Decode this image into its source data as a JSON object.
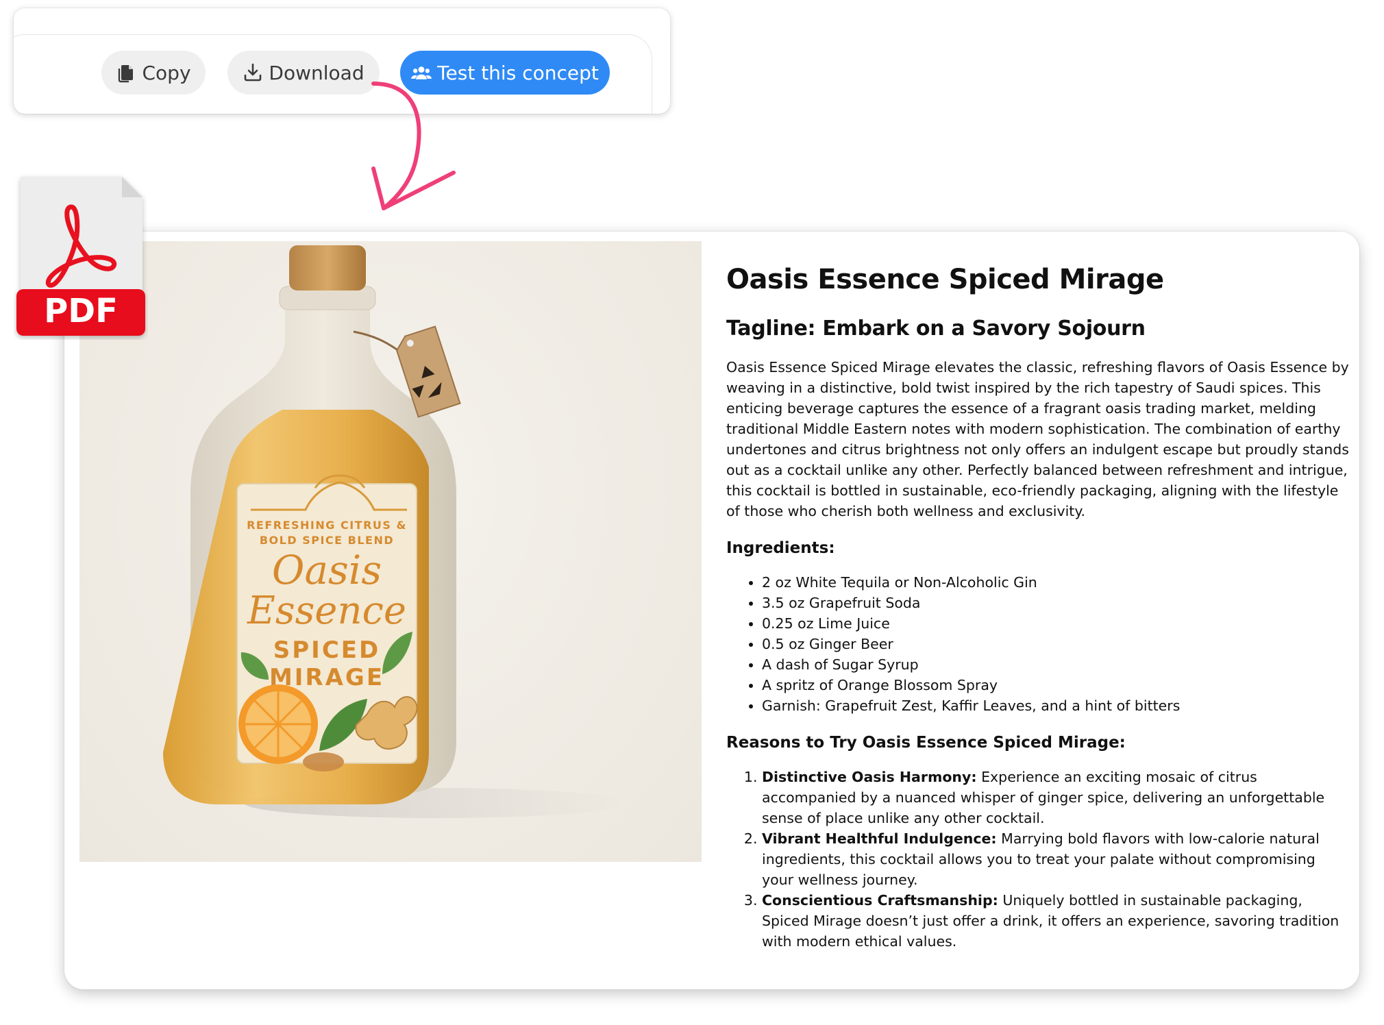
{
  "toolbar": {
    "copy_label": "Copy",
    "download_label": "Download",
    "test_label": "Test this concept",
    "accent_color": "#2f8af5"
  },
  "pdf_badge": {
    "label": "PDF",
    "color": "#e8111f"
  },
  "product_label": {
    "line1": "REFRESHING CITRUS &",
    "line2": "BOLD SPICE BLEND",
    "brand_1": "Oasis",
    "brand_2": "Essence",
    "name_1": "SPICED",
    "name_2": "MIRAGE"
  },
  "document": {
    "title": "Oasis Essence Spiced Mirage",
    "tagline": "Tagline: Embark on a Savory Sojourn",
    "description": "Oasis Essence Spiced Mirage elevates the classic, refreshing flavors of Oasis Essence by weaving in a distinctive, bold twist inspired by the rich tapestry of Saudi spices. This enticing beverage captures the essence of a fragrant oasis trading market, melding traditional Middle Eastern notes with modern sophistication. The combination of earthy undertones and citrus brightness not only offers an indulgent escape but proudly stands out as a cocktail unlike any other. Perfectly balanced between refreshment and intrigue, this cocktail is bottled in sustainable, eco-friendly packaging, aligning with the lifestyle of those who cherish both wellness and exclusivity.",
    "ingredients_heading": "Ingredients:",
    "ingredients": [
      "2 oz White Tequila or Non-Alcoholic Gin",
      "3.5 oz Grapefruit Soda",
      "0.25 oz Lime Juice",
      "0.5 oz Ginger Beer",
      "A dash of Sugar Syrup",
      "A spritz of Orange Blossom Spray",
      "Garnish: Grapefruit Zest, Kaffir Leaves, and a hint of bitters"
    ],
    "reasons_heading": "Reasons to Try Oasis Essence Spiced Mirage:",
    "reasons": [
      {
        "title": "Distinctive Oasis Harmony:",
        "text": " Experience an exciting mosaic of citrus accompanied by a nuanced whisper of ginger spice, delivering an unforgettable sense of place unlike any other cocktail."
      },
      {
        "title": "Vibrant Healthful Indulgence:",
        "text": " Marrying bold flavors with low-calorie natural ingredients, this cocktail allows you to treat your palate without compromising your wellness journey."
      },
      {
        "title": "Conscientious Craftsmanship:",
        "text": " Uniquely bottled in sustainable packaging, Spiced Mirage doesn’t just offer a drink, it offers an experience, savoring tradition with modern ethical values."
      }
    ]
  }
}
